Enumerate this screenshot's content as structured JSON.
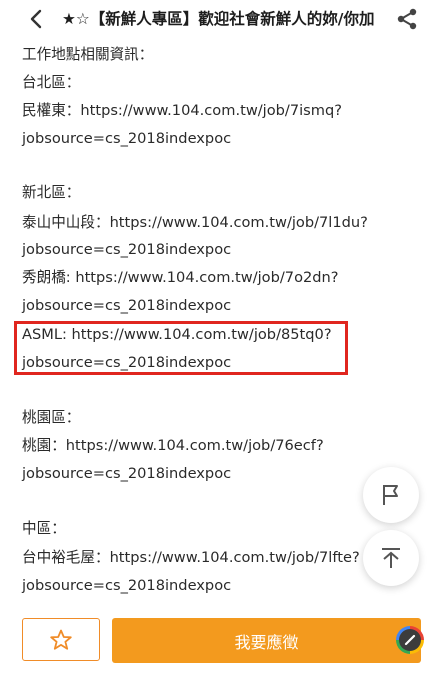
{
  "header": {
    "title": "★☆【新鮮人專區】歡迎社會新鮮人的妳/你加",
    "back_icon": "chevron-left-icon",
    "share_icon": "share-icon"
  },
  "content": {
    "lines": [
      "工作地點相關資訊：",
      "台北區：",
      "民權東：https://www.104.com.tw/job/7ismq?",
      "jobsource=cs_2018indexpoc",
      "新北區：",
      "泰山中山段：https://www.104.com.tw/job/7l1du?",
      "jobsource=cs_2018indexpoc",
      "秀朗橋: https://www.104.com.tw/job/7o2dn?",
      "jobsource=cs_2018indexpoc",
      "ASML:  https://www.104.com.tw/job/85tq0?",
      "jobsource=cs_2018indexpoc",
      "桃園區：",
      "桃園：https://www.104.com.tw/job/76ecf?",
      "jobsource=cs_2018indexpoc",
      "中區：",
      "台中裕毛屋：https://www.104.com.tw/job/7lfte?",
      "jobsource=cs_2018indexpoc"
    ]
  },
  "floating": {
    "flag_icon": "flag-icon",
    "top_icon": "scroll-to-top-icon"
  },
  "bottom_bar": {
    "favorite_icon": "star-outline-icon",
    "apply_label": "我要應徵",
    "edit_icon": "pencil-icon"
  },
  "colors": {
    "accent": "#f39a1e",
    "highlight_border": "#e0261f"
  }
}
